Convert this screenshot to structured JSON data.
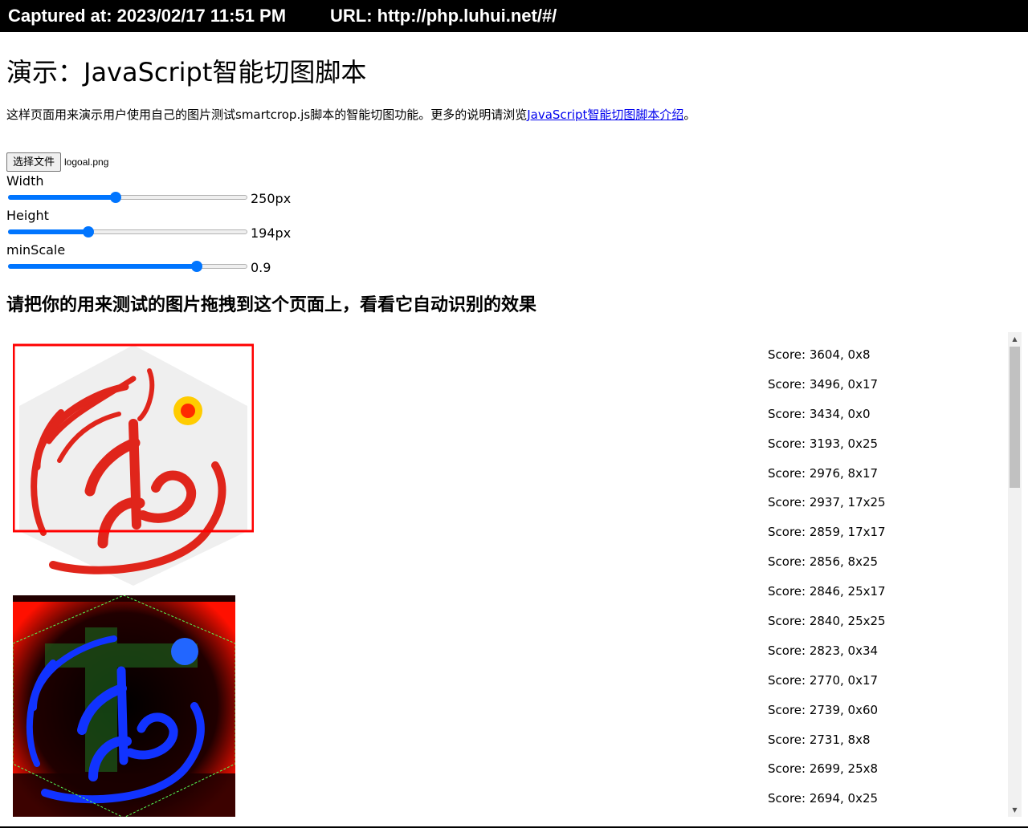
{
  "capture": {
    "captured_at": "Captured at: 2023/02/17 11:51 PM",
    "url": "URL: http://php.luhui.net/#/"
  },
  "page": {
    "title": "演示：JavaScript智能切图脚本",
    "intro_text": "这样页面用来演示用户使用自己的图片测试smartcrop.js脚本的智能切图功能。更多的说明请浏览",
    "intro_link": "JavaScript智能切图脚本介绍",
    "intro_end": "。",
    "drop_hint": "请把你的用来测试的图片拖拽到这个页面上，看看它自动识别的效果"
  },
  "file": {
    "button_label": "选择文件",
    "filename": "logoal.png"
  },
  "controls": {
    "width": {
      "label": "Width",
      "value": "250px",
      "fraction": 0.45
    },
    "height": {
      "label": "Height",
      "value": "194px",
      "fraction": 0.335
    },
    "minscale": {
      "label": "minScale",
      "value": "0.9",
      "fraction": 0.79
    }
  },
  "scores": [
    "Score: 3604, 0x8",
    "Score: 3496, 0x17",
    "Score: 3434, 0x0",
    "Score: 3193, 0x25",
    "Score: 2976, 8x17",
    "Score: 2937, 17x25",
    "Score: 2859, 17x17",
    "Score: 2856, 8x25",
    "Score: 2846, 25x17",
    "Score: 2840, 25x25",
    "Score: 2823, 0x34",
    "Score: 2770, 0x17",
    "Score: 2739, 0x60",
    "Score: 2731, 8x8",
    "Score: 2699, 25x8",
    "Score: 2694, 0x25"
  ],
  "colors": {
    "accent": "#0075ff",
    "crop_box": "#ff0000",
    "logo_red": "#e0251b",
    "link": "#0000ee"
  }
}
